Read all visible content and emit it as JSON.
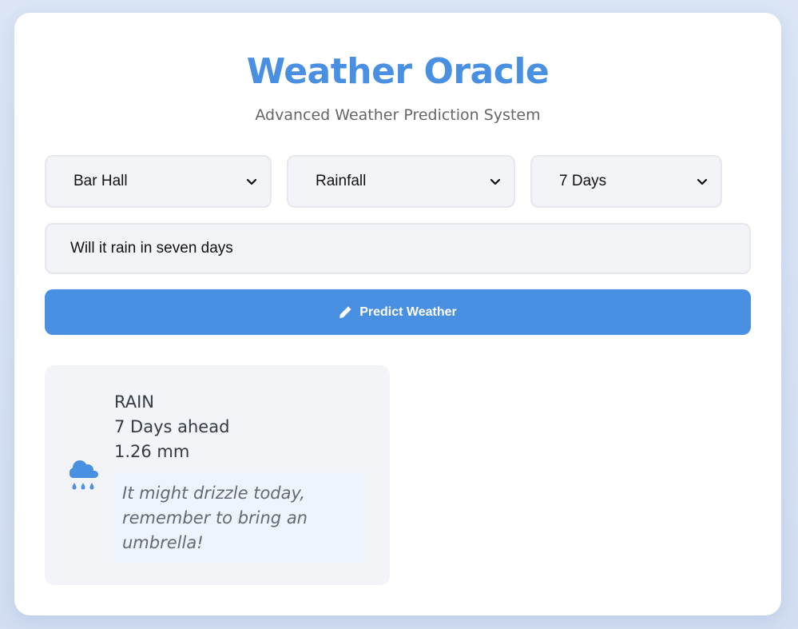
{
  "header": {
    "title": "Weather Oracle",
    "subtitle": "Advanced Weather Prediction System"
  },
  "controls": {
    "location": {
      "selected": "Bar Hall"
    },
    "metric": {
      "selected": "Rainfall"
    },
    "days": {
      "selected": "7 Days"
    },
    "query": {
      "value": "Will it rain in seven days"
    },
    "predict_button": {
      "label": "Predict Weather",
      "icon": "pencil-icon"
    }
  },
  "result": {
    "icon": "cloud-rain-icon",
    "type": "RAIN",
    "days_ahead": "7 Days ahead",
    "value": "1.26 mm",
    "advice": "It might drizzle today, remember to bring an umbrella!"
  },
  "colors": {
    "accent": "#4a90e2",
    "card_bg": "#ffffff",
    "page_bg": "#dce6f6",
    "field_bg": "#f3f4f8",
    "advice_bg": "#edf4fd"
  }
}
